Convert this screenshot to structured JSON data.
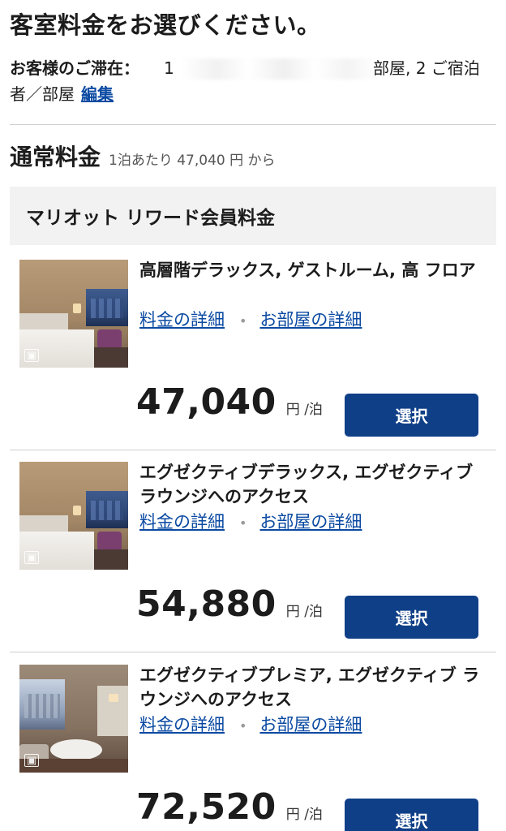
{
  "page_title": "客室料金をお選びください。",
  "stay": {
    "label": "お客様のご滞在：",
    "value_prefix": "1",
    "value_suffix": "部屋, 2 ご宿泊",
    "line2": "者／部屋",
    "edit_label": "編集"
  },
  "regular_rate": {
    "title": "通常料金",
    "subtitle": "1泊あたり 47,040 円 から"
  },
  "member_rate_label": "マリオット リワード会員料金",
  "link_labels": {
    "rate_details": "料金の詳細",
    "room_details": "お部屋の詳細"
  },
  "rooms": [
    {
      "name": "高層階デラックス, ゲストルーム, 高 フロア",
      "price": "47,040",
      "unit": "円 /泊",
      "select_label": "選択"
    },
    {
      "name": "エグゼクティブデラックス, エグゼクティブ ラウンジへのアクセス",
      "price": "54,880",
      "unit": "円 /泊",
      "select_label": "選択"
    },
    {
      "name": "エグゼクティブプレミア, エグゼクティブ ラウンジへのアクセス",
      "price": "72,520",
      "unit": "円 /泊",
      "select_label": "選択"
    }
  ],
  "icons": {
    "gallery": "image-gallery-icon"
  },
  "colors": {
    "link": "#0b4aa2",
    "button": "#0f3f87",
    "member_bg": "#f2f2f2"
  }
}
